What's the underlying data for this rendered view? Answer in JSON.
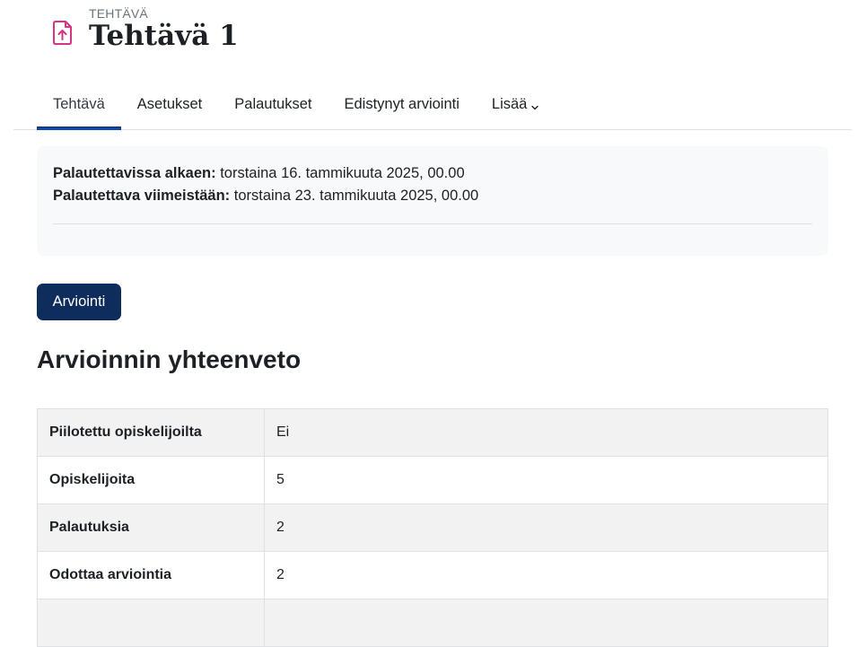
{
  "header": {
    "module_type": "TEHTÄVÄ",
    "title": "Tehtävä 1",
    "icon": "assignment-upload-icon",
    "icon_color": "#d63384"
  },
  "nav": {
    "tabs": [
      {
        "label": "Tehtävä",
        "active": true
      },
      {
        "label": "Asetukset",
        "active": false
      },
      {
        "label": "Palautukset",
        "active": false
      },
      {
        "label": "Edistynyt arviointi",
        "active": false
      },
      {
        "label": "Lisää",
        "active": false,
        "dropdown": true
      }
    ]
  },
  "dates": {
    "opened_label": "Palautettavissa alkaen:",
    "opened_value": "torstaina 16. tammikuuta 2025, 00.00",
    "due_label": "Palautettava viimeistään:",
    "due_value": "torstaina 23. tammikuuta 2025, 00.00"
  },
  "grade_button": {
    "label": "Arviointi",
    "color": "#0f2d5c"
  },
  "summary": {
    "title": "Arvioinnin yhteenveto",
    "rows": [
      {
        "label": "Piilotettu opiskelijoilta",
        "value": "Ei"
      },
      {
        "label": "Opiskelijoita",
        "value": "5"
      },
      {
        "label": "Palautuksia",
        "value": "2"
      },
      {
        "label": "Odottaa arviointia",
        "value": "2"
      },
      {
        "label": "",
        "value": ""
      }
    ]
  }
}
